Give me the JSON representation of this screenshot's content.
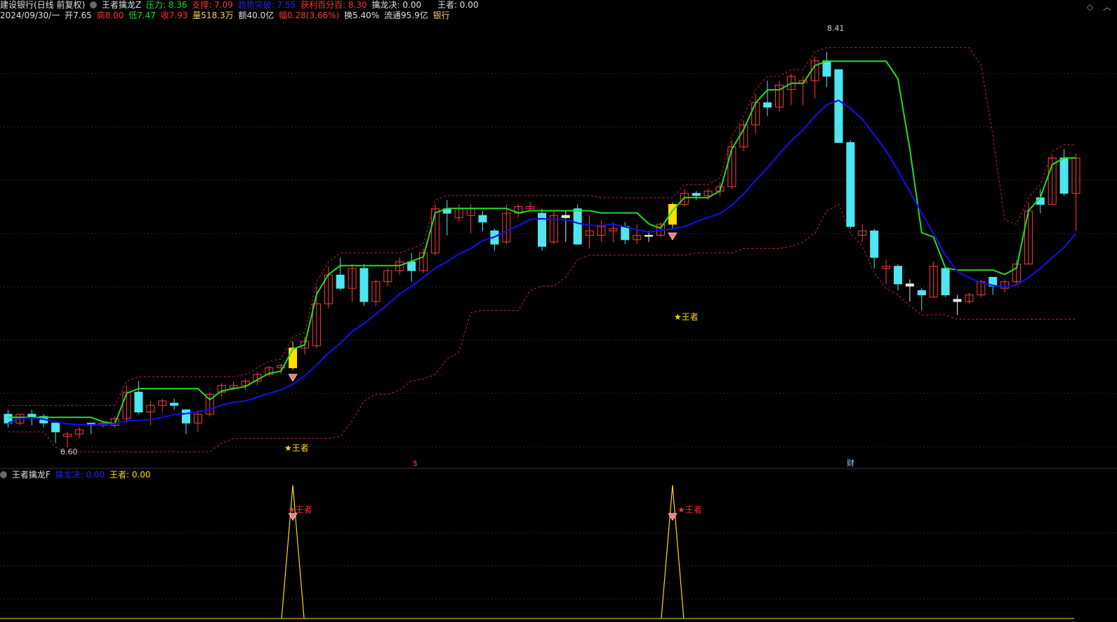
{
  "header": {
    "stock_name": "建设银行(日线 前复权)",
    "indicator_name": "王者擒龙Z",
    "pressure": "压力: 8.36",
    "support": "支撑: 7.09",
    "breakout": "趋势突破: 7.55",
    "profit_pct": "获利百分百: 8.30",
    "qinlong": "擒龙决: 0.00",
    "wangzhe": "王者: 0.00",
    "date": "2024/09/30/一",
    "open": "开7.65",
    "high": "高8.00",
    "low": "低7.47",
    "close": "收7.93",
    "volume": "量518.3万",
    "amount": "额40.0亿",
    "change": "幅0.28(3.66%)",
    "turnover": "换5.40%",
    "float": "流通95.9亿",
    "sector": "银行"
  },
  "sub_header": {
    "indicator_name": "王者擒龙F",
    "qinlong": "擒龙决: 0.00",
    "wangzhe": "王者: 0.00"
  },
  "annotations": {
    "high_price": "8.41",
    "low_price": "6.60",
    "wangzhe_1": "★王者",
    "wangzhe_2": "★王者",
    "sub_wangzhe_1": "★王者",
    "sub_wangzhe_2": "★王者",
    "marker_s": "$",
    "marker_cai": "财"
  },
  "colors": {
    "up": "#ff3b3b",
    "down": "#4ee6f0",
    "green_line": "#22dd22",
    "blue_line": "#1010dd",
    "dotted": "#cc2222",
    "signal": "#ffdd00"
  },
  "chart_data": {
    "type": "candlestick",
    "price_range": [
      6.55,
      8.55
    ],
    "y_grid_dotted": true,
    "candles": [
      {
        "o": 6.77,
        "h": 6.79,
        "l": 6.71,
        "c": 6.73,
        "dir": "down"
      },
      {
        "o": 6.73,
        "h": 6.77,
        "l": 6.72,
        "c": 6.77,
        "dir": "up"
      },
      {
        "o": 6.77,
        "h": 6.79,
        "l": 6.72,
        "c": 6.76,
        "dir": "down"
      },
      {
        "o": 6.76,
        "h": 6.77,
        "l": 6.71,
        "c": 6.73,
        "dir": "down"
      },
      {
        "o": 6.73,
        "h": 6.73,
        "l": 6.64,
        "c": 6.69,
        "dir": "down"
      },
      {
        "o": 6.67,
        "h": 6.69,
        "l": 6.62,
        "c": 6.68,
        "dir": "up"
      },
      {
        "o": 6.68,
        "h": 6.71,
        "l": 6.66,
        "c": 6.7,
        "dir": "up"
      },
      {
        "o": 6.73,
        "h": 6.73,
        "l": 6.68,
        "c": 6.72,
        "dir": "down"
      },
      {
        "o": 6.72,
        "h": 6.74,
        "l": 6.71,
        "c": 6.73,
        "dir": "up"
      },
      {
        "o": 6.72,
        "h": 6.76,
        "l": 6.71,
        "c": 6.75,
        "dir": "up"
      },
      {
        "o": 6.75,
        "h": 6.9,
        "l": 6.73,
        "c": 6.87,
        "dir": "up"
      },
      {
        "o": 6.87,
        "h": 6.92,
        "l": 6.77,
        "c": 6.78,
        "dir": "down"
      },
      {
        "o": 6.78,
        "h": 6.83,
        "l": 6.72,
        "c": 6.81,
        "dir": "up"
      },
      {
        "o": 6.81,
        "h": 6.84,
        "l": 6.78,
        "c": 6.83,
        "dir": "up"
      },
      {
        "o": 6.82,
        "h": 6.84,
        "l": 6.79,
        "c": 6.81,
        "dir": "down"
      },
      {
        "o": 6.79,
        "h": 6.79,
        "l": 6.68,
        "c": 6.73,
        "dir": "down"
      },
      {
        "o": 6.73,
        "h": 6.79,
        "l": 6.69,
        "c": 6.77,
        "dir": "up"
      },
      {
        "o": 6.77,
        "h": 6.87,
        "l": 6.76,
        "c": 6.86,
        "dir": "up"
      },
      {
        "o": 6.87,
        "h": 6.91,
        "l": 6.85,
        "c": 6.9,
        "dir": "up"
      },
      {
        "o": 6.9,
        "h": 6.92,
        "l": 6.88,
        "c": 6.89,
        "dir": "up"
      },
      {
        "o": 6.9,
        "h": 6.93,
        "l": 6.88,
        "c": 6.92,
        "dir": "up"
      },
      {
        "o": 6.92,
        "h": 6.96,
        "l": 6.9,
        "c": 6.95,
        "dir": "up"
      },
      {
        "o": 6.95,
        "h": 6.99,
        "l": 6.94,
        "c": 6.98,
        "dir": "up"
      },
      {
        "o": 6.98,
        "h": 7.0,
        "l": 6.95,
        "c": 6.99,
        "dir": "up"
      },
      {
        "o": 6.98,
        "h": 7.1,
        "l": 6.97,
        "c": 7.07,
        "dir": "signal"
      },
      {
        "o": 7.07,
        "h": 7.12,
        "l": 7.04,
        "c": 7.1,
        "dir": "up"
      },
      {
        "o": 7.08,
        "h": 7.35,
        "l": 7.07,
        "c": 7.27,
        "dir": "up"
      },
      {
        "o": 7.27,
        "h": 7.44,
        "l": 7.25,
        "c": 7.4,
        "dir": "up"
      },
      {
        "o": 7.4,
        "h": 7.48,
        "l": 7.33,
        "c": 7.34,
        "dir": "down"
      },
      {
        "o": 7.34,
        "h": 7.45,
        "l": 7.28,
        "c": 7.43,
        "dir": "up"
      },
      {
        "o": 7.43,
        "h": 7.45,
        "l": 7.26,
        "c": 7.28,
        "dir": "down"
      },
      {
        "o": 7.28,
        "h": 7.38,
        "l": 7.26,
        "c": 7.37,
        "dir": "up"
      },
      {
        "o": 7.37,
        "h": 7.43,
        "l": 7.35,
        "c": 7.42,
        "dir": "up"
      },
      {
        "o": 7.42,
        "h": 7.48,
        "l": 7.4,
        "c": 7.46,
        "dir": "up"
      },
      {
        "o": 7.46,
        "h": 7.5,
        "l": 7.37,
        "c": 7.42,
        "dir": "down"
      },
      {
        "o": 7.42,
        "h": 7.52,
        "l": 7.41,
        "c": 7.5,
        "dir": "up"
      },
      {
        "o": 7.5,
        "h": 7.72,
        "l": 7.49,
        "c": 7.7,
        "dir": "up"
      },
      {
        "o": 7.7,
        "h": 7.74,
        "l": 7.58,
        "c": 7.68,
        "dir": "down"
      },
      {
        "o": 7.66,
        "h": 7.72,
        "l": 7.64,
        "c": 7.7,
        "dir": "up"
      },
      {
        "o": 7.7,
        "h": 7.72,
        "l": 7.59,
        "c": 7.67,
        "dir": "up"
      },
      {
        "o": 7.67,
        "h": 7.69,
        "l": 7.6,
        "c": 7.64,
        "dir": "down"
      },
      {
        "o": 7.6,
        "h": 7.61,
        "l": 7.51,
        "c": 7.54,
        "dir": "down"
      },
      {
        "o": 7.55,
        "h": 7.72,
        "l": 7.54,
        "c": 7.68,
        "dir": "up"
      },
      {
        "o": 7.68,
        "h": 7.72,
        "l": 7.66,
        "c": 7.71,
        "dir": "up"
      },
      {
        "o": 7.71,
        "h": 7.73,
        "l": 7.69,
        "c": 7.7,
        "dir": "up"
      },
      {
        "o": 7.68,
        "h": 7.7,
        "l": 7.51,
        "c": 7.53,
        "dir": "down"
      },
      {
        "o": 7.55,
        "h": 7.69,
        "l": 7.54,
        "c": 7.67,
        "dir": "up"
      },
      {
        "o": 7.66,
        "h": 7.69,
        "l": 7.55,
        "c": 7.67,
        "dir": "doji"
      },
      {
        "o": 7.7,
        "h": 7.72,
        "l": 7.54,
        "c": 7.54,
        "dir": "down"
      },
      {
        "o": 7.6,
        "h": 7.67,
        "l": 7.52,
        "c": 7.58,
        "dir": "up"
      },
      {
        "o": 7.58,
        "h": 7.65,
        "l": 7.55,
        "c": 7.62,
        "dir": "up"
      },
      {
        "o": 7.6,
        "h": 7.64,
        "l": 7.55,
        "c": 7.61,
        "dir": "up"
      },
      {
        "o": 7.62,
        "h": 7.64,
        "l": 7.54,
        "c": 7.56,
        "dir": "down"
      },
      {
        "o": 7.56,
        "h": 7.63,
        "l": 7.54,
        "c": 7.58,
        "dir": "up"
      },
      {
        "o": 7.58,
        "h": 7.6,
        "l": 7.55,
        "c": 7.58,
        "dir": "doji"
      },
      {
        "o": 7.58,
        "h": 7.64,
        "l": 7.57,
        "c": 7.63,
        "dir": "up"
      },
      {
        "o": 7.63,
        "h": 7.73,
        "l": 7.61,
        "c": 7.72,
        "dir": "signal"
      },
      {
        "o": 7.72,
        "h": 7.79,
        "l": 7.71,
        "c": 7.77,
        "dir": "up"
      },
      {
        "o": 7.77,
        "h": 7.78,
        "l": 7.74,
        "c": 7.76,
        "dir": "down"
      },
      {
        "o": 7.76,
        "h": 7.79,
        "l": 7.74,
        "c": 7.78,
        "dir": "up"
      },
      {
        "o": 7.78,
        "h": 7.82,
        "l": 7.76,
        "c": 7.8,
        "dir": "up"
      },
      {
        "o": 7.8,
        "h": 8.01,
        "l": 7.79,
        "c": 7.98,
        "dir": "up"
      },
      {
        "o": 7.98,
        "h": 8.1,
        "l": 7.96,
        "c": 8.08,
        "dir": "up"
      },
      {
        "o": 8.08,
        "h": 8.22,
        "l": 8.04,
        "c": 8.18,
        "dir": "up"
      },
      {
        "o": 8.18,
        "h": 8.28,
        "l": 8.12,
        "c": 8.16,
        "dir": "down"
      },
      {
        "o": 8.16,
        "h": 8.28,
        "l": 8.14,
        "c": 8.26,
        "dir": "up"
      },
      {
        "o": 8.24,
        "h": 8.31,
        "l": 8.17,
        "c": 8.3,
        "dir": "up"
      },
      {
        "o": 8.27,
        "h": 8.3,
        "l": 8.17,
        "c": 8.28,
        "dir": "up"
      },
      {
        "o": 8.28,
        "h": 8.39,
        "l": 8.2,
        "c": 8.37,
        "dir": "up"
      },
      {
        "o": 8.37,
        "h": 8.41,
        "l": 8.25,
        "c": 8.3,
        "dir": "down"
      },
      {
        "o": 8.33,
        "h": 8.33,
        "l": 8.0,
        "c": 8.0,
        "dir": "down"
      },
      {
        "o": 8.0,
        "h": 8.01,
        "l": 7.61,
        "c": 7.62,
        "dir": "down"
      },
      {
        "o": 7.6,
        "h": 7.63,
        "l": 7.55,
        "c": 7.58,
        "dir": "up"
      },
      {
        "o": 7.6,
        "h": 7.61,
        "l": 7.43,
        "c": 7.48,
        "dir": "down"
      },
      {
        "o": 7.43,
        "h": 7.47,
        "l": 7.36,
        "c": 7.44,
        "dir": "up"
      },
      {
        "o": 7.44,
        "h": 7.45,
        "l": 7.33,
        "c": 7.36,
        "dir": "down"
      },
      {
        "o": 7.36,
        "h": 7.38,
        "l": 7.28,
        "c": 7.35,
        "dir": "doji"
      },
      {
        "o": 7.33,
        "h": 7.34,
        "l": 7.24,
        "c": 7.31,
        "dir": "down"
      },
      {
        "o": 7.3,
        "h": 7.46,
        "l": 7.3,
        "c": 7.44,
        "dir": "up"
      },
      {
        "o": 7.43,
        "h": 7.44,
        "l": 7.3,
        "c": 7.31,
        "dir": "down"
      },
      {
        "o": 7.28,
        "h": 7.31,
        "l": 7.22,
        "c": 7.29,
        "dir": "doji"
      },
      {
        "o": 7.28,
        "h": 7.32,
        "l": 7.27,
        "c": 7.31,
        "dir": "up"
      },
      {
        "o": 7.31,
        "h": 7.38,
        "l": 7.3,
        "c": 7.37,
        "dir": "up"
      },
      {
        "o": 7.39,
        "h": 7.39,
        "l": 7.31,
        "c": 7.35,
        "dir": "down"
      },
      {
        "o": 7.34,
        "h": 7.38,
        "l": 7.32,
        "c": 7.37,
        "dir": "up"
      },
      {
        "o": 7.37,
        "h": 7.47,
        "l": 7.36,
        "c": 7.45,
        "dir": "up"
      },
      {
        "o": 7.45,
        "h": 7.73,
        "l": 7.45,
        "c": 7.69,
        "dir": "up"
      },
      {
        "o": 7.75,
        "h": 7.79,
        "l": 7.68,
        "c": 7.72,
        "dir": "down"
      },
      {
        "o": 7.72,
        "h": 7.94,
        "l": 7.72,
        "c": 7.93,
        "dir": "up"
      },
      {
        "o": 7.93,
        "h": 7.97,
        "l": 7.76,
        "c": 7.77,
        "dir": "down"
      },
      {
        "o": 7.77,
        "h": 7.95,
        "l": 7.6,
        "c": 7.93,
        "dir": "up"
      }
    ],
    "sub_chart": {
      "baseline_label": "",
      "signal_indices": [
        24,
        56
      ]
    }
  }
}
